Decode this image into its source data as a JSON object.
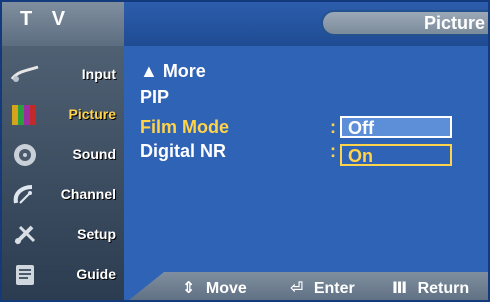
{
  "header": {
    "app_title": "T V",
    "page_title": "Picture"
  },
  "sidebar": {
    "items": [
      {
        "label": "Input",
        "icon": "input-cable-icon"
      },
      {
        "label": "Picture",
        "icon": "picture-colorbars-icon",
        "active": true
      },
      {
        "label": "Sound",
        "icon": "speaker-icon"
      },
      {
        "label": "Channel",
        "icon": "satellite-dish-icon"
      },
      {
        "label": "Setup",
        "icon": "tools-icon"
      },
      {
        "label": "Guide",
        "icon": "program-guide-icon"
      }
    ]
  },
  "menu": {
    "items": [
      {
        "label": "▲ More"
      },
      {
        "label": "PIP"
      },
      {
        "label": "Film Mode",
        "highlight": true
      },
      {
        "label": "Digital NR"
      }
    ],
    "colon": ":",
    "options": [
      {
        "label": "Off",
        "state": "off"
      },
      {
        "label": "On",
        "state": "on"
      }
    ]
  },
  "footer": {
    "move": {
      "glyph": "⇕",
      "label": "Move"
    },
    "enter": {
      "glyph": "⏎",
      "label": "Enter"
    },
    "return": {
      "glyph": "Ⅲ",
      "label": "Return"
    }
  },
  "colors": {
    "panel_blue": "#2f63b6",
    "highlight_yellow": "#ffd34a",
    "option_blue": "#5c8fd8"
  }
}
